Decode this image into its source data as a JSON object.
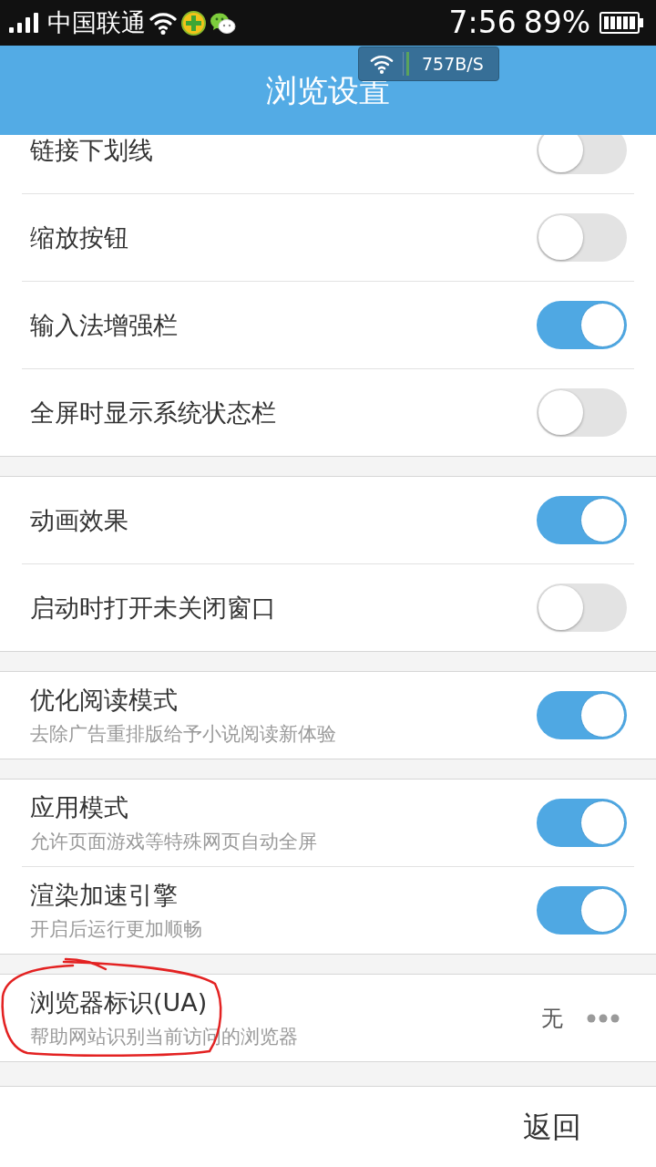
{
  "status_bar": {
    "carrier": "中国联通",
    "time": "7:56",
    "battery": "89%"
  },
  "speed_overlay": {
    "speed": "757B/S"
  },
  "header": {
    "title": "浏览设置"
  },
  "sections": [
    {
      "items": [
        {
          "kind": "toggle",
          "label": "链接下划线",
          "on": false
        },
        {
          "kind": "toggle",
          "label": "缩放按钮",
          "on": false
        },
        {
          "kind": "toggle",
          "label": "输入法增强栏",
          "on": true
        },
        {
          "kind": "toggle",
          "label": "全屏时显示系统状态栏",
          "on": false
        }
      ]
    },
    {
      "items": [
        {
          "kind": "toggle",
          "label": "动画效果",
          "on": true
        },
        {
          "kind": "toggle",
          "label": "启动时打开未关闭窗口",
          "on": false
        }
      ]
    },
    {
      "items": [
        {
          "kind": "toggle",
          "label": "优化阅读模式",
          "subtitle": "去除广告重排版给予小说阅读新体验",
          "on": true
        }
      ]
    },
    {
      "items": [
        {
          "kind": "toggle",
          "label": "应用模式",
          "subtitle": "允许页面游戏等特殊网页自动全屏",
          "on": true
        },
        {
          "kind": "toggle",
          "label": "渲染加速引擎",
          "subtitle": "开启后运行更加顺畅",
          "on": true
        }
      ]
    },
    {
      "items": [
        {
          "kind": "choice",
          "label": "浏览器标识(UA)",
          "subtitle": "帮助网站识别当前访问的浏览器",
          "value": "无"
        }
      ]
    }
  ],
  "footer": {
    "back_button": "返回"
  }
}
